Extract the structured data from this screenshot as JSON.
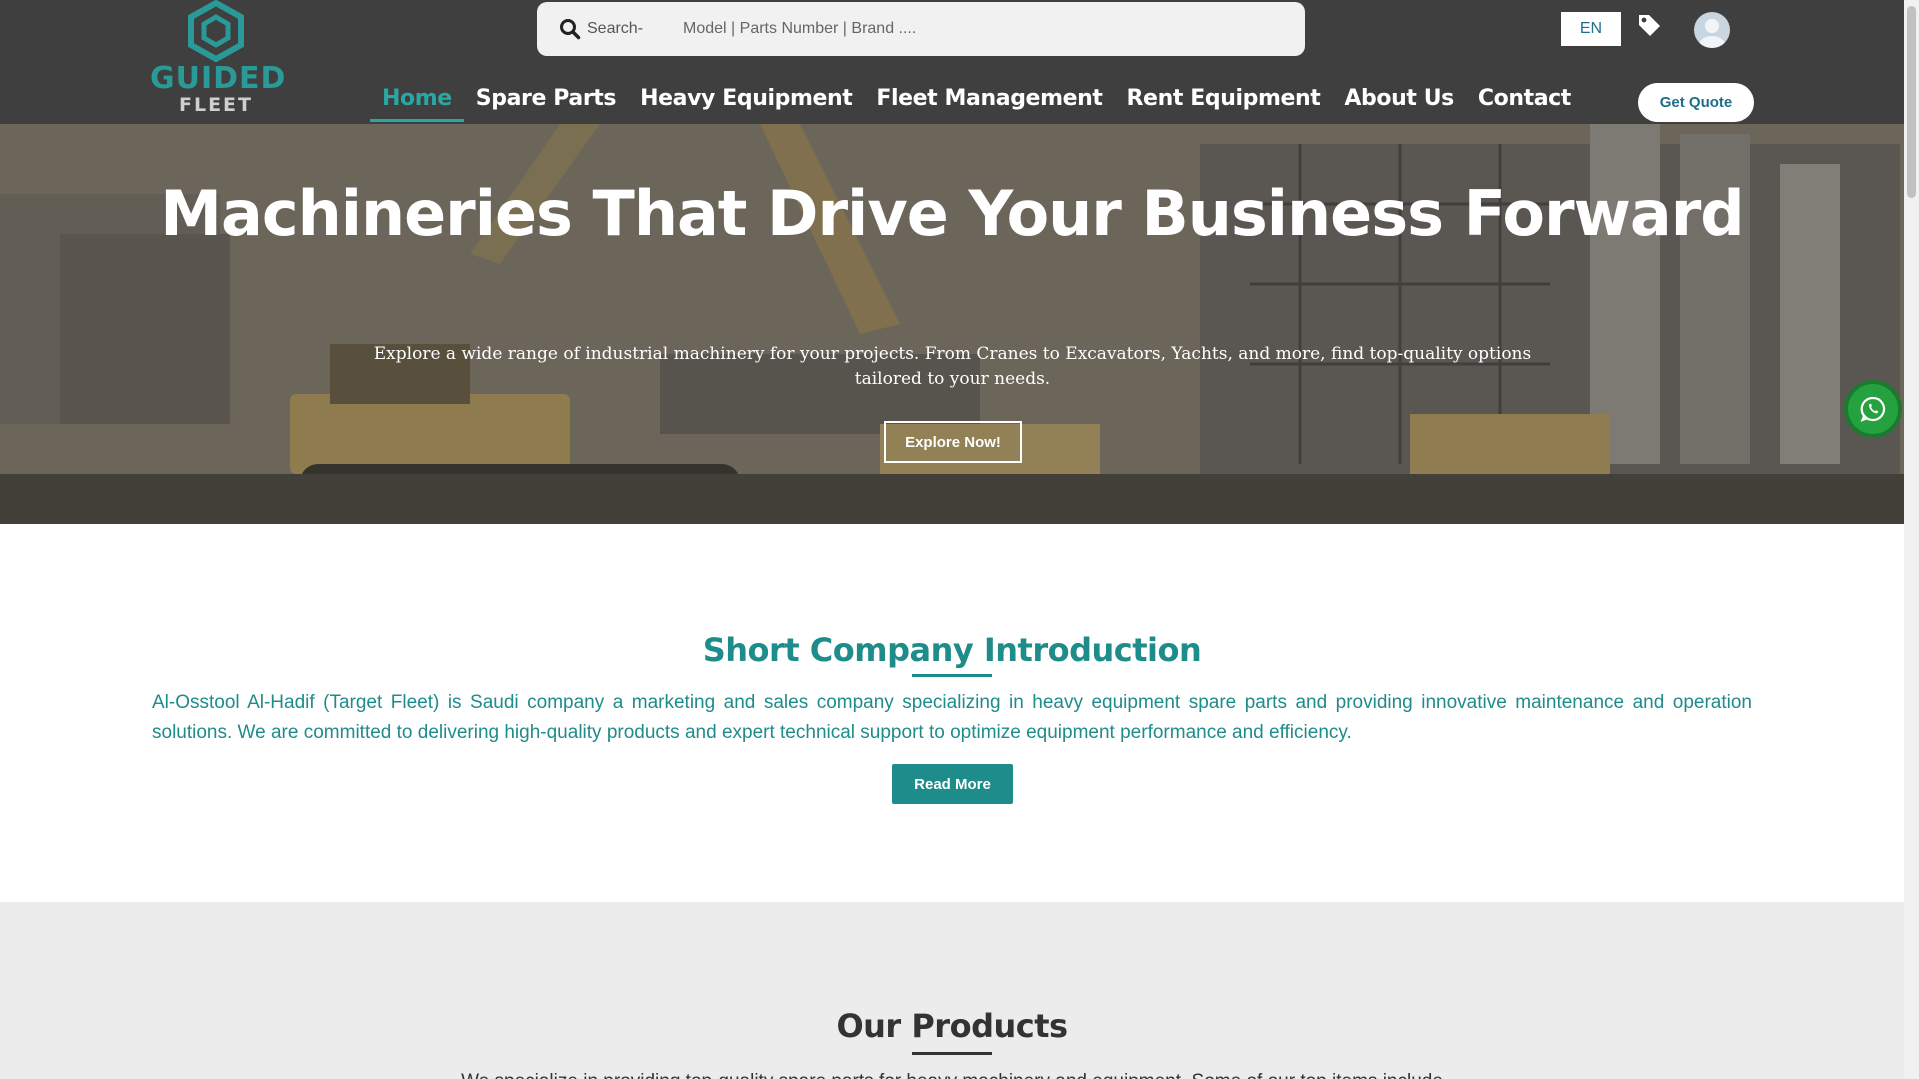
{
  "brand": {
    "name_line1": "GUIDED",
    "name_line2": "FLEET",
    "logo_icon": "hexagon-logo-icon",
    "color_primary": "#2a9a98"
  },
  "header": {
    "search": {
      "label": "Search-",
      "placeholder": "Model | Parts Number | Brand ....",
      "icon": "search-icon"
    },
    "language": "EN",
    "tag_icon": "tag-icon",
    "avatar_icon": "user-avatar-icon",
    "nav": [
      {
        "label": "Home",
        "active": true
      },
      {
        "label": "Spare Parts",
        "active": false
      },
      {
        "label": "Heavy Equipment",
        "active": false
      },
      {
        "label": "Fleet Management",
        "active": false
      },
      {
        "label": "Rent Equipment",
        "active": false
      },
      {
        "label": "About Us",
        "active": false
      },
      {
        "label": "Contact",
        "active": false
      }
    ],
    "quote_button": "Get Quote"
  },
  "hero": {
    "title": "Machineries That Drive Your Business Forward",
    "subtitle": "Explore a wide range of industrial machinery for your projects. From Cranes to Excavators, Yachts, and more, find top-quality options tailored to your needs.",
    "cta": "Explore Now!"
  },
  "whatsapp": {
    "icon": "whatsapp-icon",
    "color": "#25a23f"
  },
  "intro": {
    "title": "Short Company Introduction",
    "text": "Al-Osstool Al-Hadif (Target Fleet) is Saudi company a marketing and sales company specializing in heavy equipment spare parts and providing innovative maintenance and operation solutions. We are committed to delivering high-quality products and expert technical support to optimize equipment performance and efficiency.",
    "button": "Read More"
  },
  "products": {
    "title": "Our Products",
    "text": "We specialize in providing top-quality spare parts for heavy machinery and equipment. Some of our top items include"
  }
}
